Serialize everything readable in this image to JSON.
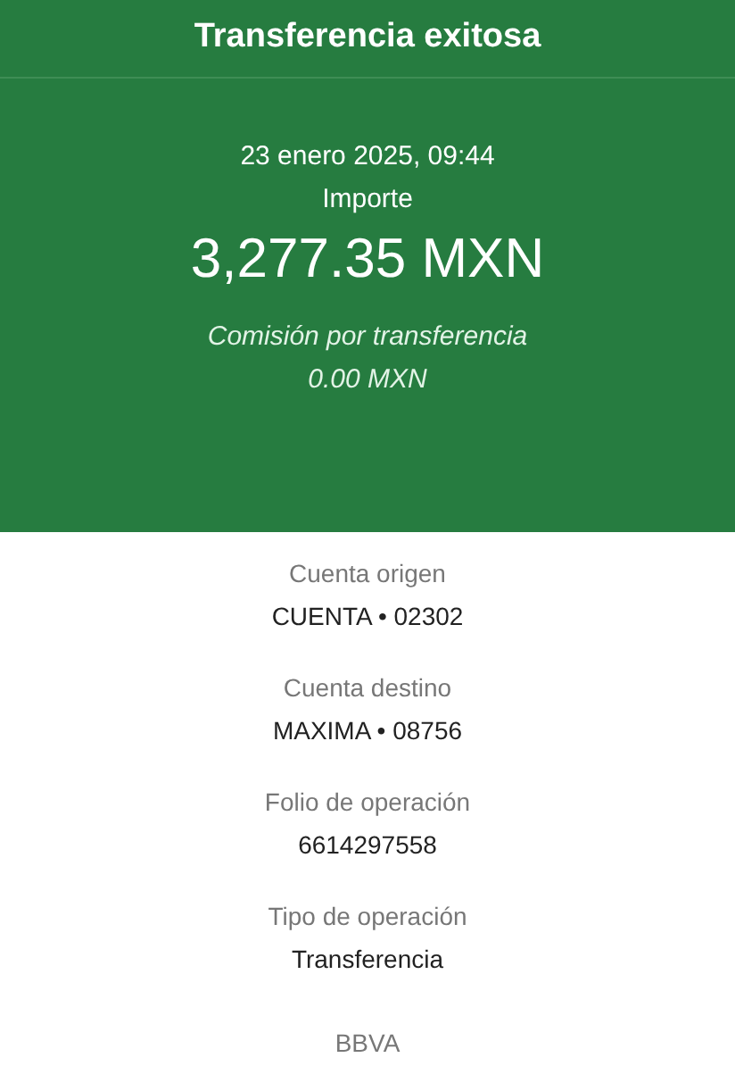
{
  "header": {
    "title": "Transferencia exitosa"
  },
  "summary": {
    "date": "23 enero 2025, 09:44",
    "amount_label": "Importe",
    "amount": "3,277.35 MXN",
    "fee_label": "Comisión por transferencia",
    "fee": "0.00 MXN"
  },
  "details": [
    {
      "label": "Cuenta origen",
      "value": "CUENTA • 02302"
    },
    {
      "label": "Cuenta destino",
      "value": "MAXIMA • 08756"
    },
    {
      "label": "Folio de operación",
      "value": "6614297558"
    },
    {
      "label": "Tipo de operación",
      "value": "Transferencia"
    }
  ],
  "footer": "BBVA"
}
